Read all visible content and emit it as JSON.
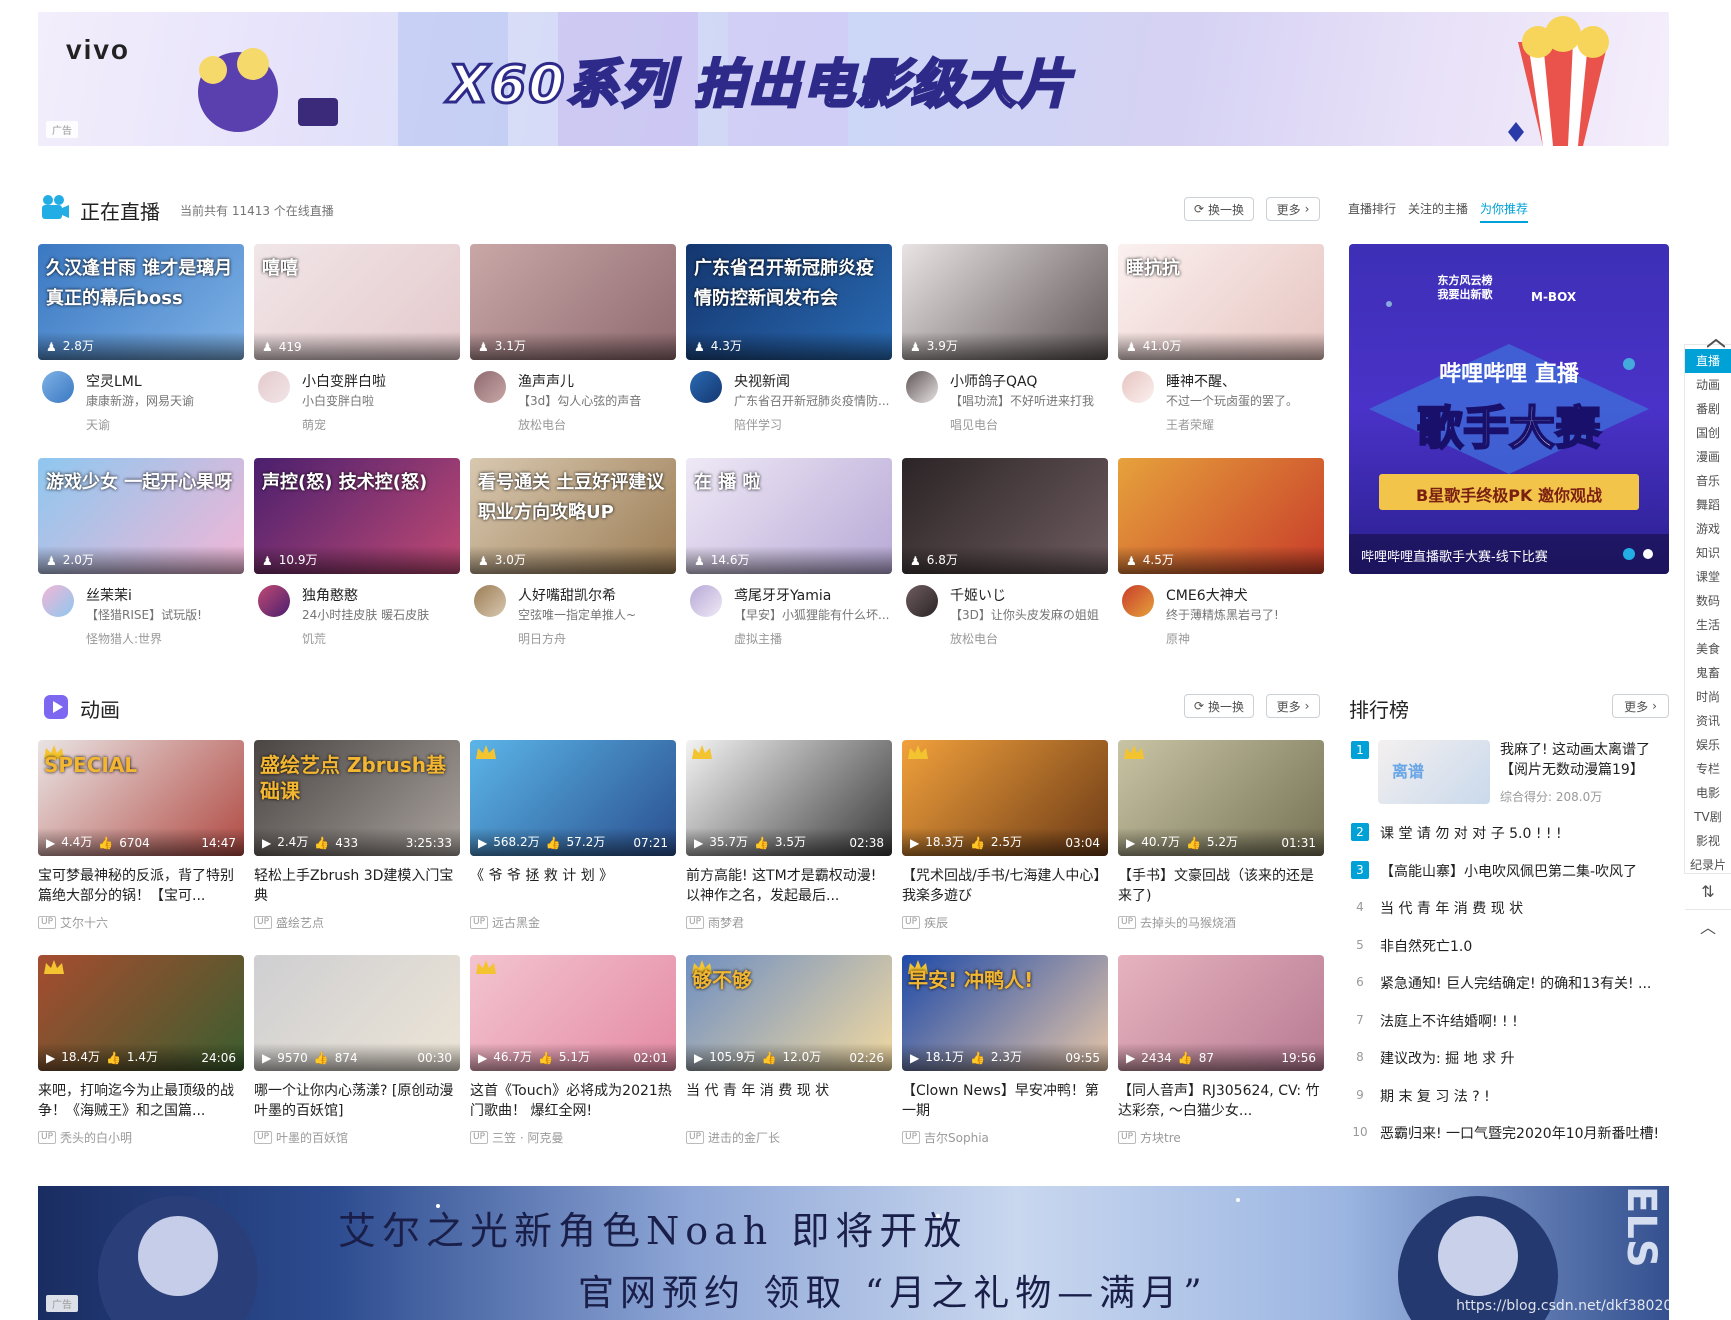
{
  "top_banner": {
    "brand": "vivo",
    "headline": "X60系列 拍出电影级大片",
    "ad_tag": "广告"
  },
  "live": {
    "title": "正在直播",
    "online_text": "当前共有 11413 个在线直播",
    "refresh": "换一换",
    "more": "更多",
    "tabs": [
      "直播排行",
      "关注的主播",
      "为你推荐"
    ],
    "cards": [
      {
        "cover_text": "久汉逢甘雨 谁才是璃月 真正的幕后boss",
        "viewers": "2.8万",
        "name": "空灵LML",
        "desc": "康康新游，网易天谕",
        "cat": "天谕",
        "c1": "#3a78c2",
        "c2": "#7fb2e6"
      },
      {
        "cover_text": "嘻嘻",
        "viewers": "419",
        "name": "小白变胖白啦",
        "desc": "小白变胖白啦",
        "cat": "萌宠",
        "c1": "#f1e6e8",
        "c2": "#e4c9cc"
      },
      {
        "cover_text": "",
        "viewers": "3.1万",
        "name": "渔声声儿",
        "desc": "【3d】勾人心弦的声音",
        "cat": "放松电台",
        "c1": "#c9a7a7",
        "c2": "#8e6a6f"
      },
      {
        "cover_text": "广东省召开新冠肺炎疫情防控新闻发布会",
        "viewers": "4.3万",
        "name": "央视新闻",
        "desc": "广东省召开新冠肺炎疫情防...",
        "cat": "陪伴学习",
        "c1": "#14366f",
        "c2": "#2a6bb4"
      },
      {
        "cover_text": "",
        "viewers": "3.9万",
        "name": "小师鸽子QAQ",
        "desc": "【唱功流】不好听进来打我",
        "cat": "唱见电台",
        "c1": "#e9e3e3",
        "c2": "#5f5656"
      },
      {
        "cover_text": "睡抗抗",
        "viewers": "41.0万",
        "name": "睡神不醒、",
        "desc": "不过一个玩卤蛋的罢了。",
        "cat": "王者荣耀",
        "c1": "#fbf1f0",
        "c2": "#e6c4c0"
      },
      {
        "cover_text": "游戏少女 一起开心果呀",
        "viewers": "2.0万",
        "name": "丝茉茉i",
        "desc": "【怪猎RISE】试玩版!",
        "cat": "怪物猎人:世界",
        "c1": "#8ec7ef",
        "c2": "#f2b6d6"
      },
      {
        "cover_text": "声控(怒) 技术控(怒)",
        "viewers": "10.9万",
        "name": "独角憨憨",
        "desc": "24小时挂皮肤 暖石皮肤",
        "cat": "饥荒",
        "c1": "#4a1f6e",
        "c2": "#c14a74"
      },
      {
        "cover_text": "看号通关 土豆好评建议 职业方向攻略UP",
        "viewers": "3.0万",
        "name": "人好嘴甜凯尔希",
        "desc": "空弦唯一指定单推人~",
        "cat": "明日方舟",
        "c1": "#d8c8b0",
        "c2": "#9c7d55"
      },
      {
        "cover_text": "在 播 啦",
        "viewers": "14.6万",
        "name": "鸢尾牙牙Yamia",
        "desc": "【早安】小狐狸能有什么坏...",
        "cat": "虚拟主播",
        "c1": "#efe9f6",
        "c2": "#b7a9d6"
      },
      {
        "cover_text": "",
        "viewers": "6.8万",
        "name": "千姬いじ",
        "desc": "【3D】让你头皮发麻の姐姐",
        "cat": "放松电台",
        "c1": "#2b2426",
        "c2": "#6e5c5f"
      },
      {
        "cover_text": "",
        "viewers": "4.5万",
        "name": "CME6大神犬",
        "desc": "终于薄精炼黑岩弓了!",
        "cat": "原神",
        "c1": "#e6a23c",
        "c2": "#c83c2a"
      }
    ],
    "feature": {
      "caption": "哔哩哔哩直播歌手大赛-线下比赛",
      "badge1": "东方风云榜 我要出新歌",
      "badge2": "M-BOX",
      "title_top": "哔哩哔哩 直播",
      "title_main": "歌手大赛",
      "subtitle": "B星歌手终极PK 邀你观战"
    }
  },
  "anime": {
    "title": "动画",
    "refresh": "换一换",
    "more": "更多",
    "videos": [
      {
        "play": "4.4万",
        "likes": "6704",
        "dur": "14:47",
        "title": "宝可梦最神秘的反派，背了特别篇绝大部分的锅！【宝可...",
        "up": "艾尔十六",
        "crown": true,
        "cover_text": "SPECIAL",
        "c1": "#e9e4e4",
        "c2": "#b14a43"
      },
      {
        "play": "2.4万",
        "likes": "433",
        "dur": "3:25:33",
        "title": "轻松上手Zbrush 3D建模入门宝典",
        "up": "盛绘艺点",
        "crown": false,
        "cover_text": "盛绘艺点 Zbrush基础课",
        "c1": "#4a4543",
        "c2": "#a9a29d"
      },
      {
        "play": "568.2万",
        "likes": "57.2万",
        "dur": "07:21",
        "title": "《 爷 爷 拯 救 计 划 》",
        "up": "远古黑金",
        "crown": true,
        "cover_text": "",
        "c1": "#5bb5e8",
        "c2": "#2a4f8f"
      },
      {
        "play": "35.7万",
        "likes": "3.5万",
        "dur": "02:38",
        "title": "前方高能! 这TM才是霸权动漫! 以神作之名，发起最后...",
        "up": "雨梦君",
        "crown": true,
        "cover_text": "",
        "c1": "#f3f3f3",
        "c2": "#3a3a3a"
      },
      {
        "play": "18.3万",
        "likes": "2.5万",
        "dur": "03:04",
        "title": "【咒术回战/手书/七海建人中心】我楽多遊び",
        "up": "疾辰",
        "crown": true,
        "cover_text": "",
        "c1": "#f2a13c",
        "c2": "#6b3a16"
      },
      {
        "play": "40.7万",
        "likes": "5.2万",
        "dur": "01:31",
        "title": "【手书】文豪回战（该来的还是来了)",
        "up": "去掉头的马猴烧酒",
        "crown": true,
        "cover_text": "",
        "c1": "#c8c4a4",
        "c2": "#767255"
      },
      {
        "play": "18.4万",
        "likes": "1.4万",
        "dur": "24:06",
        "title": "来吧，打响迄今为止最顶级的战争！《海贼王》和之国篇...",
        "up": "秃头的白小明",
        "crown": true,
        "cover_text": "",
        "c1": "#a64c2f",
        "c2": "#3b5e2f"
      },
      {
        "play": "9570",
        "likes": "874",
        "dur": "00:30",
        "title": "哪一个让你内心荡漾? [原创动漫 叶墨的百妖馆]",
        "up": "叶墨的百妖馆",
        "crown": false,
        "cover_text": "",
        "c1": "#cfcfd2",
        "c2": "#ece4d6"
      },
      {
        "play": "46.7万",
        "likes": "5.1万",
        "dur": "02:01",
        "title": "这首《Touch》必将成为2021热门歌曲！ 爆红全网!",
        "up": "三笠 · 阿克曼",
        "crown": true,
        "cover_text": "",
        "c1": "#f3c4d0",
        "c2": "#e48aa4"
      },
      {
        "play": "105.9万",
        "likes": "12.0万",
        "dur": "02:26",
        "title": "当 代 青 年 消 费 现 状",
        "up": "进击的金厂长",
        "crown": true,
        "cover_text": "够不够",
        "c1": "#6f8fc2",
        "c2": "#f2d9a0"
      },
      {
        "play": "18.1万",
        "likes": "2.3万",
        "dur": "09:55",
        "title": "【Clown News】早安冲鸭！第一期",
        "up": "吉尔Sophia",
        "crown": true,
        "cover_text": "早安! 冲鸭人!",
        "c1": "#1e4aa8",
        "c2": "#e7c6a8"
      },
      {
        "play": "2434",
        "likes": "87",
        "dur": "19:56",
        "title": "【同人音声】RJ305624, CV: 竹达彩奈, 〜白猫少女...",
        "up": "方块tre",
        "crown": false,
        "cover_text": "",
        "c1": "#e7b3bf",
        "c2": "#b77a92"
      }
    ]
  },
  "ranking": {
    "title": "排行榜",
    "more": "更多",
    "top": {
      "title": "我麻了! 这动画太离谱了【阅片无数动漫篇19】",
      "score": "综合得分: 208.0万"
    },
    "items": [
      "课 堂 请 勿 对 对 子 5.0 ! ! !",
      "【高能山寨】小电吹风佩巴第二集-吹风了",
      "当 代 青 年 消 费 现 状",
      "非自然死亡1.0",
      "紧急通知! 巨人完结确定! 的确和13有关! ...",
      "法庭上不许结婚啊! ! !",
      "建议改为: 掘 地 求 升",
      "期 末 复 习 法 ? !",
      "恶霸归来! 一口气暨完2020年10月新番吐槽!"
    ]
  },
  "side_nav": {
    "active": "直播",
    "items": [
      "动画",
      "番剧",
      "国创",
      "漫画",
      "音乐",
      "舞蹈",
      "游戏",
      "知识",
      "课堂",
      "数码",
      "生活",
      "美食",
      "鬼畜",
      "时尚",
      "资讯",
      "娱乐",
      "专栏",
      "电影",
      "TV剧",
      "影视",
      "纪录片"
    ]
  },
  "bottom_banner": {
    "line1": "艾尔之光新角色Noah 即将开放",
    "line2": "官网预约 领取 “月之礼物—满月”",
    "ad_tag": "广告",
    "watermark": "https://blog.csdn.net/dkf38020598"
  }
}
